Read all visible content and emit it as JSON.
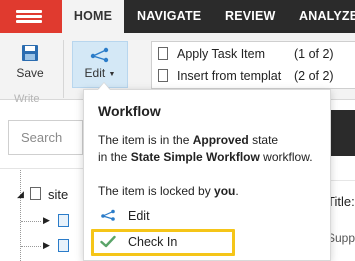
{
  "nav": {
    "tabs": [
      {
        "label": "HOME"
      },
      {
        "label": "NAVIGATE"
      },
      {
        "label": "REVIEW"
      },
      {
        "label": "ANALYZE"
      }
    ]
  },
  "ribbon": {
    "save_label": "Save",
    "edit_label": "Edit",
    "group_label": "Write",
    "tasks": [
      {
        "label": "Apply Task Item",
        "count": "(1 of 2)"
      },
      {
        "label": "Insert from templat",
        "count": "(2 of 2)"
      }
    ]
  },
  "search": {
    "placeholder": "Search"
  },
  "tree": {
    "root_label": "site"
  },
  "content": {
    "title_fragment": "Title:",
    "supp_fragment": "Supp"
  },
  "workflow_popup": {
    "title": "Workflow",
    "line1_prefix": "The item is in the ",
    "line1_bold": "Approved",
    "line1_suffix": " state",
    "line2_prefix": "in the ",
    "line2_bold": "State Simple Workflow",
    "line2_suffix": " workflow.",
    "line3_prefix": "The item is locked by ",
    "line3_bold": "you",
    "line3_suffix": ".",
    "actions": [
      {
        "label": "Edit",
        "icon": "workflow-edit-icon"
      },
      {
        "label": "Check In",
        "icon": "checkmark-icon"
      }
    ]
  },
  "colors": {
    "nav_background": "#2b2b2b",
    "menu_accent": "#e03a2f",
    "edit_button_bg": "#d4e8f6",
    "highlight": "#f5c518",
    "checkmark": "#5aa469",
    "edit_icon": "#2b7cc9"
  }
}
